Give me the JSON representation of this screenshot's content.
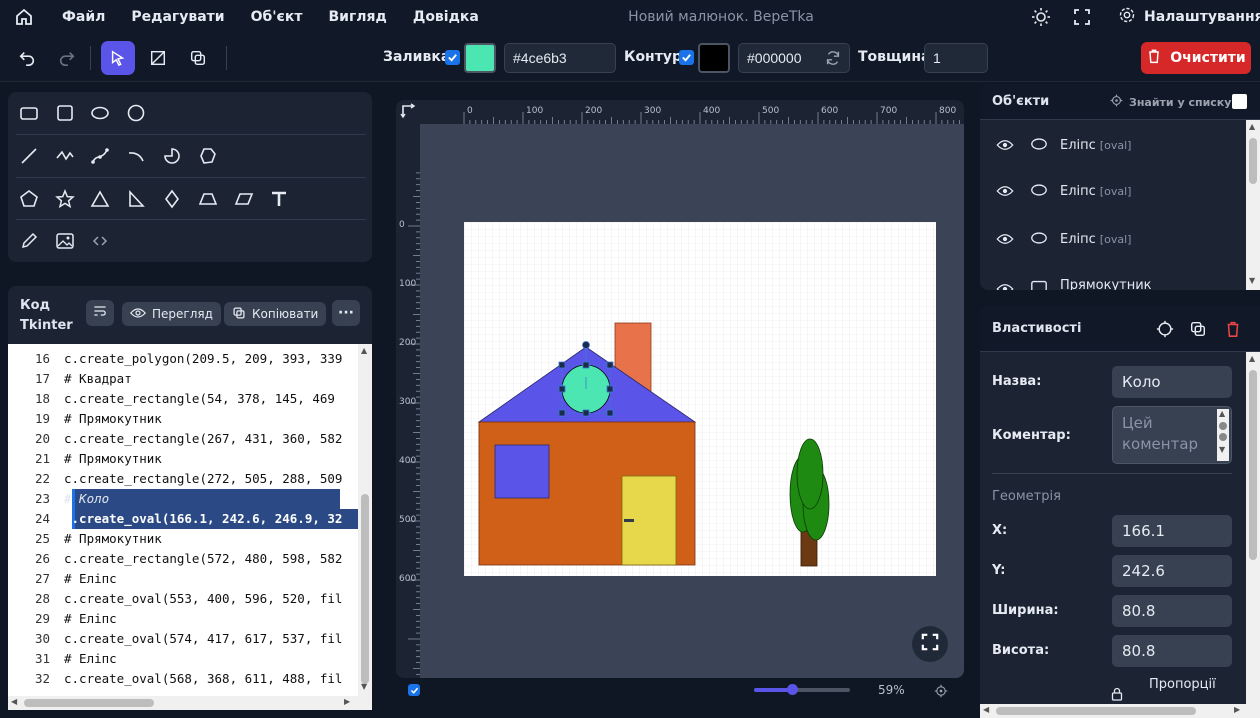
{
  "menu": {
    "items": [
      "Файл",
      "Редагувати",
      "Об'єкт",
      "Вигляд",
      "Довідка"
    ],
    "title": "Новий малюнок. ВереТka",
    "settings": "Налаштування"
  },
  "toolbar": {
    "fill_label": "Заливка:",
    "fill_color": "#4ce6b3",
    "fill_hex": "#4ce6b3",
    "outline_label": "Контур:",
    "outline_color": "#000000",
    "outline_hex": "#000000",
    "width_label": "Товщина:",
    "width_value": "1",
    "clear_label": "Очистити"
  },
  "code_panel": {
    "title_line1": "Код",
    "title_line2": "Tkinter",
    "preview_label": "Перегляд",
    "copy_label": "Копіювати",
    "lines": [
      {
        "n": "16",
        "text": "c.create_polygon(209.5, 209, 393, 339"
      },
      {
        "n": "17",
        "text": "# Квадрат"
      },
      {
        "n": "18",
        "text": "c.create_rectangle(54, 378, 145, 469"
      },
      {
        "n": "19",
        "text": "# Прямокутник"
      },
      {
        "n": "20",
        "text": "c.create_rectangle(267, 431, 360, 582"
      },
      {
        "n": "21",
        "text": "# Прямокутник"
      },
      {
        "n": "22",
        "text": "c.create_rectangle(272, 505, 288, 509"
      },
      {
        "n": "23",
        "text": "# Коло"
      },
      {
        "n": "24",
        "text": "c.create_oval(166.1, 242.6, 246.9, 32"
      },
      {
        "n": "25",
        "text": "# Прямокутник"
      },
      {
        "n": "26",
        "text": "c.create_rectangle(572, 480, 598, 582"
      },
      {
        "n": "27",
        "text": "# Еліпс"
      },
      {
        "n": "28",
        "text": "c.create_oval(553, 400, 596, 520, fil"
      },
      {
        "n": "29",
        "text": "# Еліпс"
      },
      {
        "n": "30",
        "text": "c.create_oval(574, 417, 617, 537, fil"
      },
      {
        "n": "31",
        "text": "# Еліпс"
      },
      {
        "n": "32",
        "text": "c.create_oval(568, 368, 611, 488, fil"
      }
    ]
  },
  "ruler": {
    "h": [
      "0",
      "100",
      "200",
      "300",
      "400",
      "500",
      "600",
      "700",
      "800"
    ],
    "v": [
      "0",
      "100",
      "200",
      "300",
      "400",
      "500",
      "600"
    ]
  },
  "zoom": {
    "level": "59%",
    "fraction": 0.4
  },
  "objects_panel": {
    "title": "Об'єкти",
    "find_label": "Знайти у списку",
    "items": [
      {
        "name": "Еліпс",
        "type": "[oval]"
      },
      {
        "name": "Еліпс",
        "type": "[oval]"
      },
      {
        "name": "Еліпс",
        "type": "[oval]"
      },
      {
        "name": "Прямокутник",
        "type": ""
      }
    ]
  },
  "properties": {
    "title": "Властивості",
    "name_label": "Назва:",
    "name_value": "Коло",
    "comment_label": "Коментар:",
    "comment_placeholder": "Цей коментар",
    "geometry_label": "Геометрія",
    "x_label": "X:",
    "x_value": "166.1",
    "y_label": "Y:",
    "y_value": "242.6",
    "w_label": "Ширина:",
    "w_value": "80.8",
    "h_label": "Висота:",
    "h_value": "80.8",
    "proportions_label": "Пропорції"
  },
  "colors": {
    "accent": "#5b54e8",
    "danger": "#d62828",
    "house_wall": "#d06018",
    "roof": "#5b54e8",
    "window": "#5b54e8",
    "door": "#e6d84a",
    "chimney": "#e8734a",
    "circle": "#4ce6b3",
    "tree_trunk": "#6b3a12",
    "tree_leaves": "#1f8a12"
  }
}
